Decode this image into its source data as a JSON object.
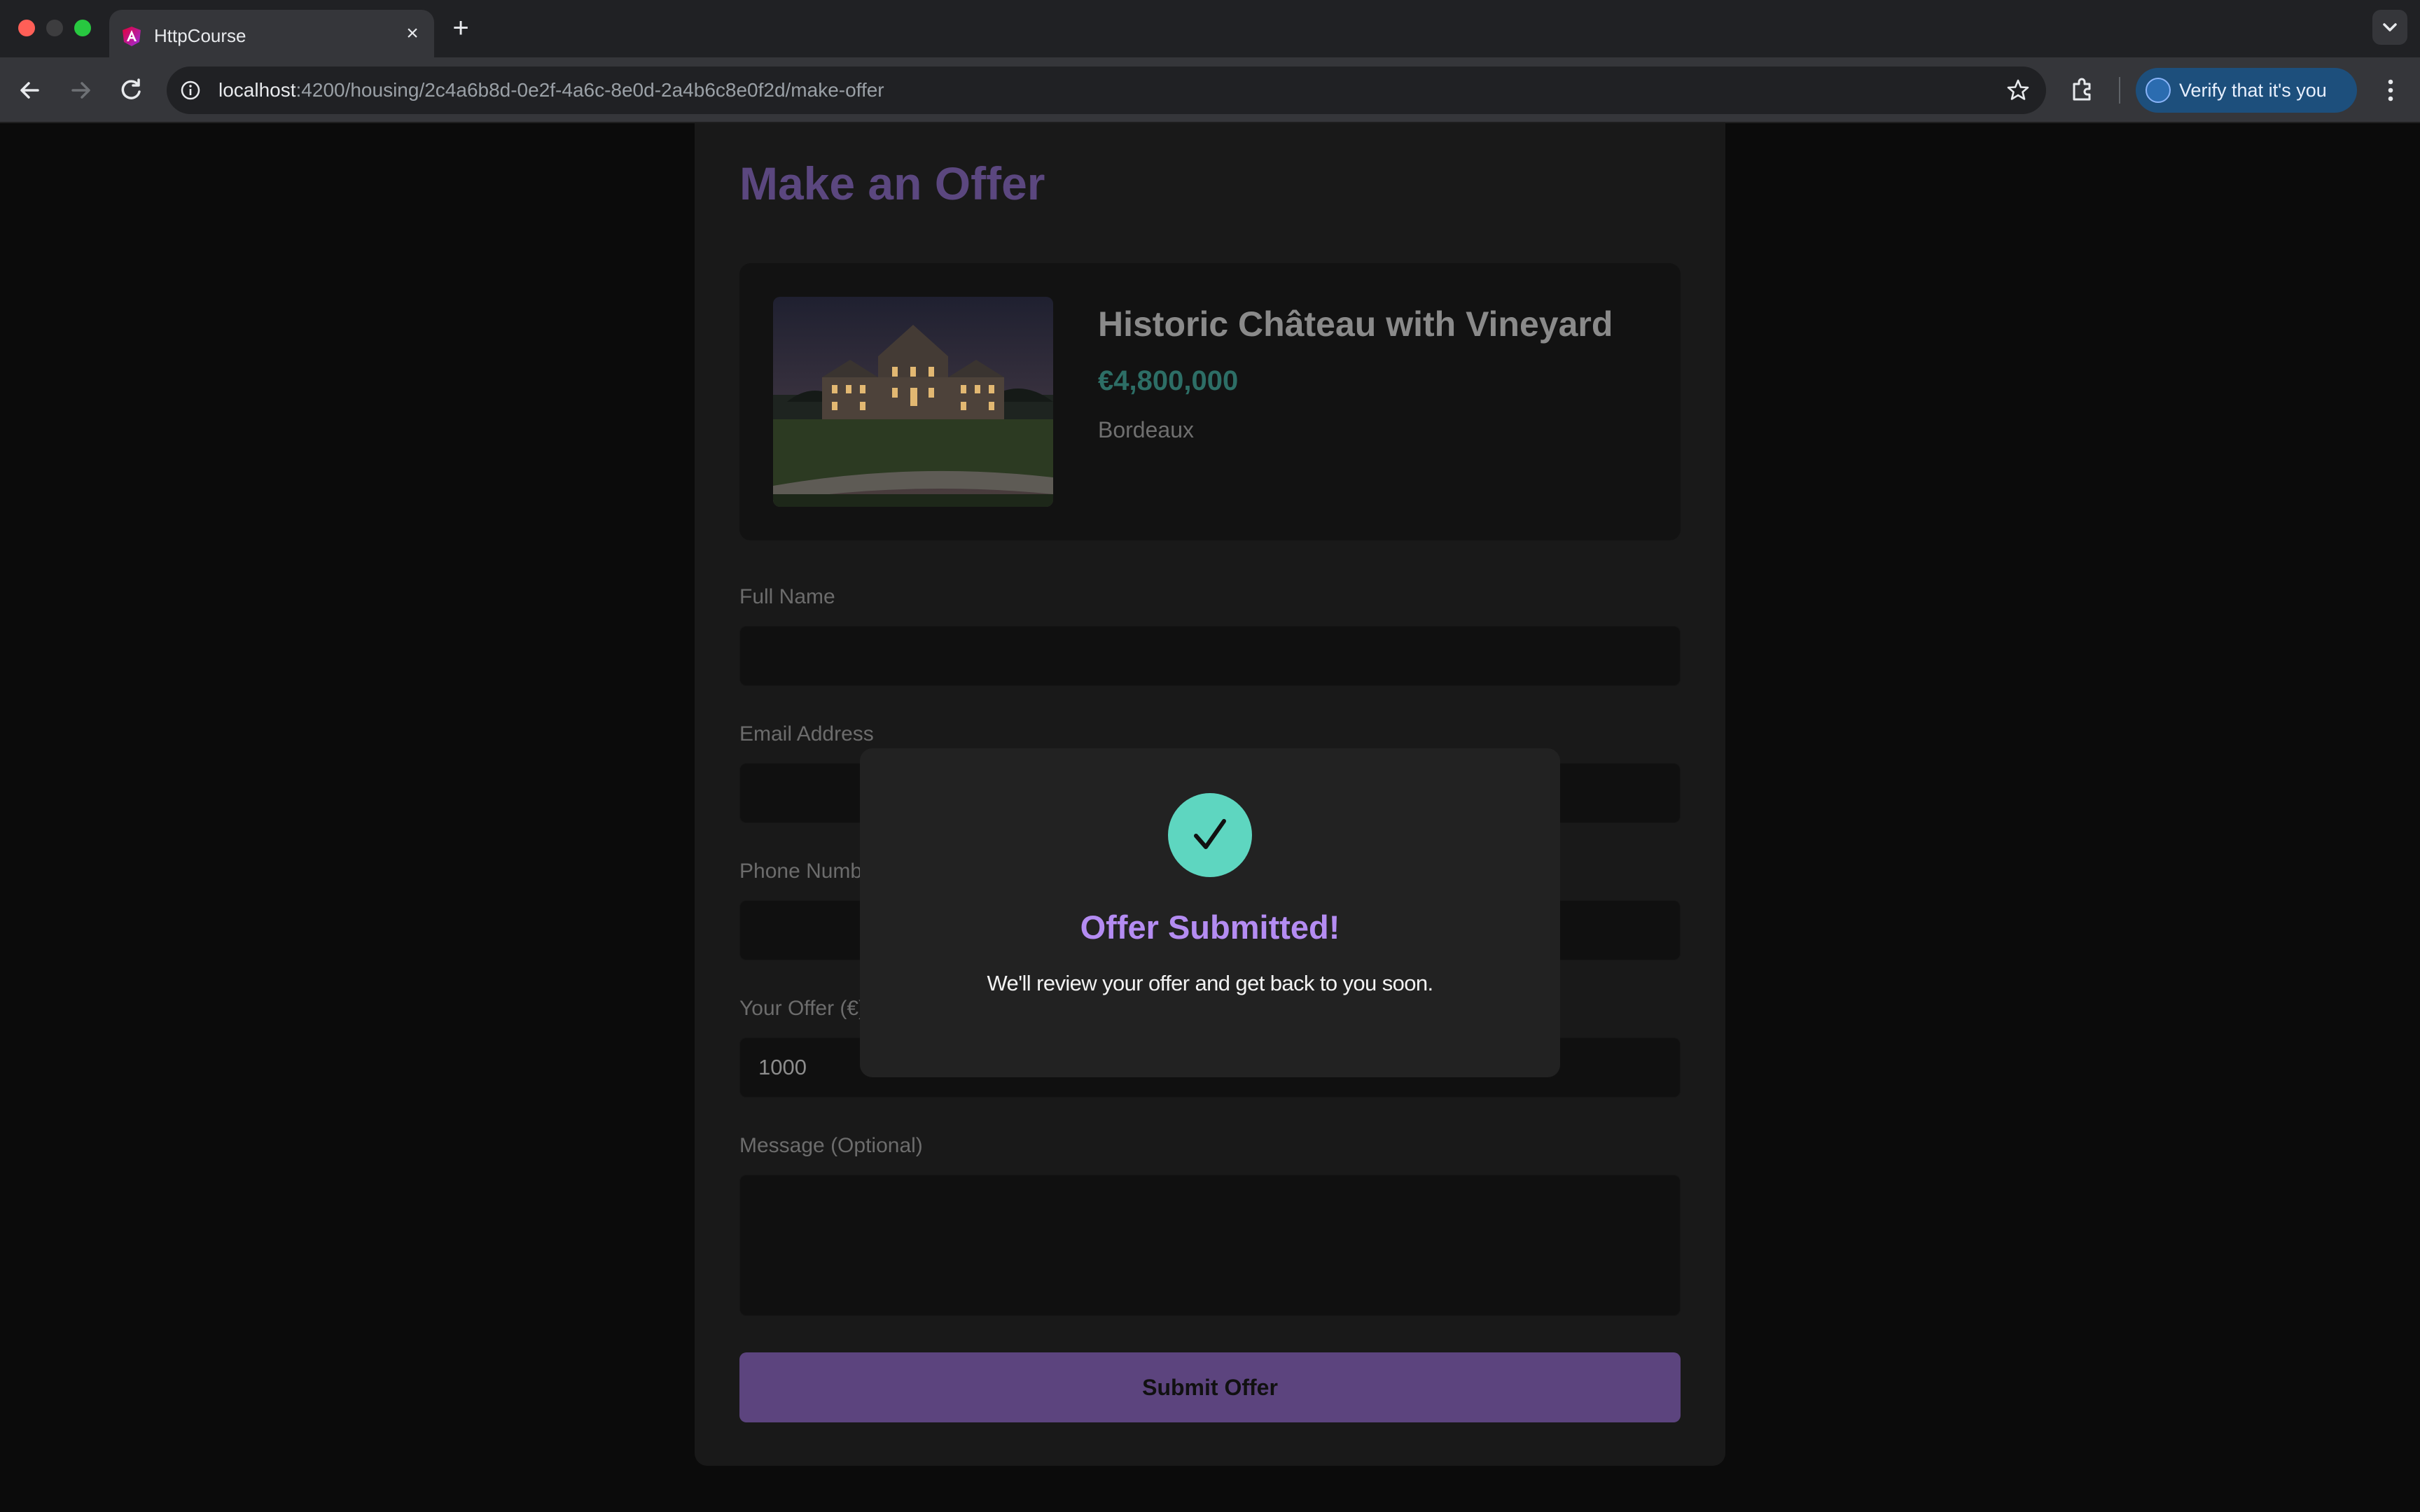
{
  "browser": {
    "tab_title": "HttpCourse",
    "new_tab_symbol": "+",
    "close_symbol": "×",
    "url_host": "localhost",
    "url_path": ":4200/housing/2c4a6b8d-0e2f-4a6c-8e0d-2a4b6c8e0f2d/make-offer",
    "verify_label": "Verify that it's you"
  },
  "page": {
    "heading": "Make an Offer",
    "property": {
      "title": "Historic Château with Vineyard",
      "price": "€4,800,000",
      "location": "Bordeaux"
    },
    "form": {
      "full_name_label": "Full Name",
      "full_name_value": "",
      "email_label": "Email Address",
      "email_value": "",
      "phone_label": "Phone Number",
      "phone_value": "",
      "offer_label": "Your Offer (€)",
      "offer_value": "1000",
      "message_label": "Message (Optional)",
      "message_value": "",
      "submit_label": "Submit Offer"
    }
  },
  "modal": {
    "title": "Offer Submitted!",
    "message": "We'll review your offer and get back to you soon."
  },
  "colors": {
    "accent_purple": "#b48cf2",
    "button_purple": "#5c447e",
    "success_teal": "#5ed6c0",
    "price_teal": "#2d6e66"
  },
  "icons": [
    "angular-favicon-icon",
    "close-icon",
    "plus-icon",
    "back-arrow-icon",
    "forward-arrow-icon",
    "reload-icon",
    "info-icon",
    "star-icon",
    "extensions-icon",
    "more-vert-icon",
    "checkmark-icon"
  ]
}
